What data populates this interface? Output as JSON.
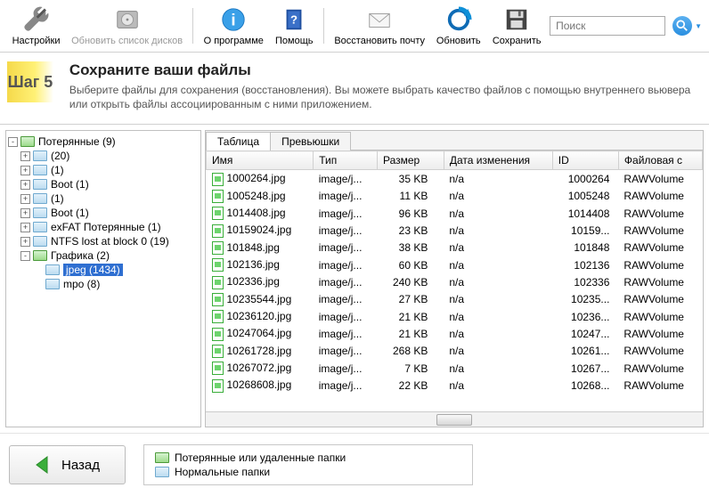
{
  "toolbar": {
    "settings": "Настройки",
    "refresh_disks": "Обновить список дисков",
    "about": "О программе",
    "help": "Помощь",
    "recover_mail": "Восстановить почту",
    "refresh": "Обновить",
    "save": "Сохранить",
    "search_placeholder": "Поиск"
  },
  "step": {
    "badge": "Шаг 5",
    "title": "Сохраните ваши файлы",
    "subtitle": "Выберите файлы для сохранения (восстановления). Вы можете выбрать качество файлов с помощью внутреннего вьювера или открыть файлы ассоциированным с ними приложением."
  },
  "tree": [
    {
      "level": 0,
      "exp": "-",
      "icon": "green",
      "label": "Потерянные (9)"
    },
    {
      "level": 1,
      "exp": "+",
      "icon": "blue",
      "label": "(20)"
    },
    {
      "level": 1,
      "exp": "+",
      "icon": "blue",
      "label": "(1)"
    },
    {
      "level": 1,
      "exp": "+",
      "icon": "blue",
      "label": "Boot (1)"
    },
    {
      "level": 1,
      "exp": "+",
      "icon": "blue",
      "label": "(1)"
    },
    {
      "level": 1,
      "exp": "+",
      "icon": "blue",
      "label": "Boot (1)"
    },
    {
      "level": 1,
      "exp": "+",
      "icon": "blue",
      "label": "exFAT Потерянные (1)"
    },
    {
      "level": 1,
      "exp": "+",
      "icon": "blue",
      "label": "NTFS lost at block 0 (19)"
    },
    {
      "level": 1,
      "exp": "-",
      "icon": "green",
      "label": "Графика (2)"
    },
    {
      "level": 2,
      "exp": " ",
      "icon": "blue",
      "label": "jpeg (1434)",
      "selected": true
    },
    {
      "level": 2,
      "exp": " ",
      "icon": "blue",
      "label": "mpo (8)"
    }
  ],
  "tabs": {
    "table": "Таблица",
    "thumbs": "Превьюшки"
  },
  "columns": [
    "Имя",
    "Тип",
    "Размер",
    "Дата изменения",
    "ID",
    "Файловая с"
  ],
  "rows": [
    {
      "name": "1000264.jpg",
      "type": "image/j...",
      "size": "35 KB",
      "date": "n/a",
      "id": "1000264",
      "fs": "RAWVolume"
    },
    {
      "name": "1005248.jpg",
      "type": "image/j...",
      "size": "11 KB",
      "date": "n/a",
      "id": "1005248",
      "fs": "RAWVolume"
    },
    {
      "name": "1014408.jpg",
      "type": "image/j...",
      "size": "96 KB",
      "date": "n/a",
      "id": "1014408",
      "fs": "RAWVolume"
    },
    {
      "name": "10159024.jpg",
      "type": "image/j...",
      "size": "23 KB",
      "date": "n/a",
      "id": "10159...",
      "fs": "RAWVolume"
    },
    {
      "name": "101848.jpg",
      "type": "image/j...",
      "size": "38 KB",
      "date": "n/a",
      "id": "101848",
      "fs": "RAWVolume"
    },
    {
      "name": "102136.jpg",
      "type": "image/j...",
      "size": "60 KB",
      "date": "n/a",
      "id": "102136",
      "fs": "RAWVolume"
    },
    {
      "name": "102336.jpg",
      "type": "image/j...",
      "size": "240 KB",
      "date": "n/a",
      "id": "102336",
      "fs": "RAWVolume"
    },
    {
      "name": "10235544.jpg",
      "type": "image/j...",
      "size": "27 KB",
      "date": "n/a",
      "id": "10235...",
      "fs": "RAWVolume"
    },
    {
      "name": "10236120.jpg",
      "type": "image/j...",
      "size": "21 KB",
      "date": "n/a",
      "id": "10236...",
      "fs": "RAWVolume"
    },
    {
      "name": "10247064.jpg",
      "type": "image/j...",
      "size": "21 KB",
      "date": "n/a",
      "id": "10247...",
      "fs": "RAWVolume"
    },
    {
      "name": "10261728.jpg",
      "type": "image/j...",
      "size": "268 KB",
      "date": "n/a",
      "id": "10261...",
      "fs": "RAWVolume"
    },
    {
      "name": "10267072.jpg",
      "type": "image/j...",
      "size": "7 KB",
      "date": "n/a",
      "id": "10267...",
      "fs": "RAWVolume"
    },
    {
      "name": "10268608.jpg",
      "type": "image/j...",
      "size": "22 KB",
      "date": "n/a",
      "id": "10268...",
      "fs": "RAWVolume"
    }
  ],
  "footer": {
    "back": "Назад",
    "legend_lost": "Потерянные или удаленные папки",
    "legend_normal": "Нормальные папки"
  }
}
